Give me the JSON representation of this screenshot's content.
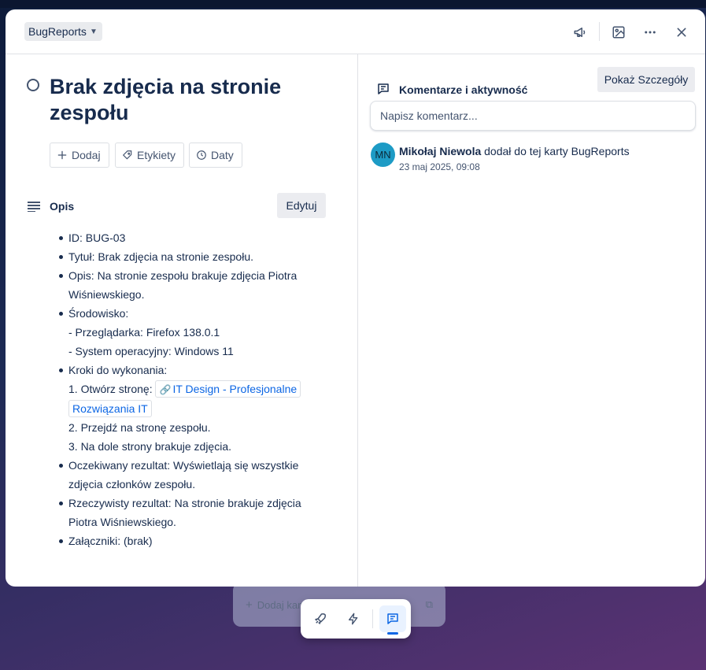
{
  "background": {
    "add_card_label": "Dodaj kartę"
  },
  "header": {
    "list_name": "BugReports"
  },
  "card": {
    "title": "Brak zdjęcia na stronie zespołu",
    "actions": {
      "add": "Dodaj",
      "labels": "Etykiety",
      "dates": "Daty"
    }
  },
  "description": {
    "heading": "Opis",
    "edit_label": "Edytuj",
    "items": {
      "id": "ID: BUG-03",
      "title": "Tytuł: Brak zdjęcia na stronie zespołu.",
      "desc": "Opis: Na stronie zespołu brakuje zdjęcia Piotra Wiśniewskiego.",
      "env": "Środowisko:",
      "env_browser": "- Przeglądarka: Firefox 138.0.1",
      "env_os": "- System operacyjny: Windows 11",
      "steps": "Kroki do wykonania:",
      "step1_prefix": "1. Otwórz stronę:",
      "step1_link": "IT Design - Profesjonalne Rozwiązania IT",
      "step2": "2. Przejdź na stronę zespołu.",
      "step3": "3. Na dole strony brakuje zdjęcia.",
      "expected": "Oczekiwany rezultat: Wyświetlają się wszystkie zdjęcia członków zespołu.",
      "actual": "Rzeczywisty rezultat: Na stronie brakuje zdjęcia Piotra Wiśniewskiego.",
      "attachments": "Załączniki: (brak)"
    }
  },
  "comments": {
    "heading": "Komentarze i aktywność",
    "details_label": "Pokaż Szczegóły",
    "input_placeholder": "Napisz komentarz..."
  },
  "activity": {
    "avatar_initials": "MN",
    "user": "Mikołaj Niewola",
    "action": "dodał do tej karty BugReports",
    "time": "23 maj 2025, 09:08"
  },
  "colors": {
    "accent": "#0c66e4",
    "avatar": "#1d9bc5"
  }
}
